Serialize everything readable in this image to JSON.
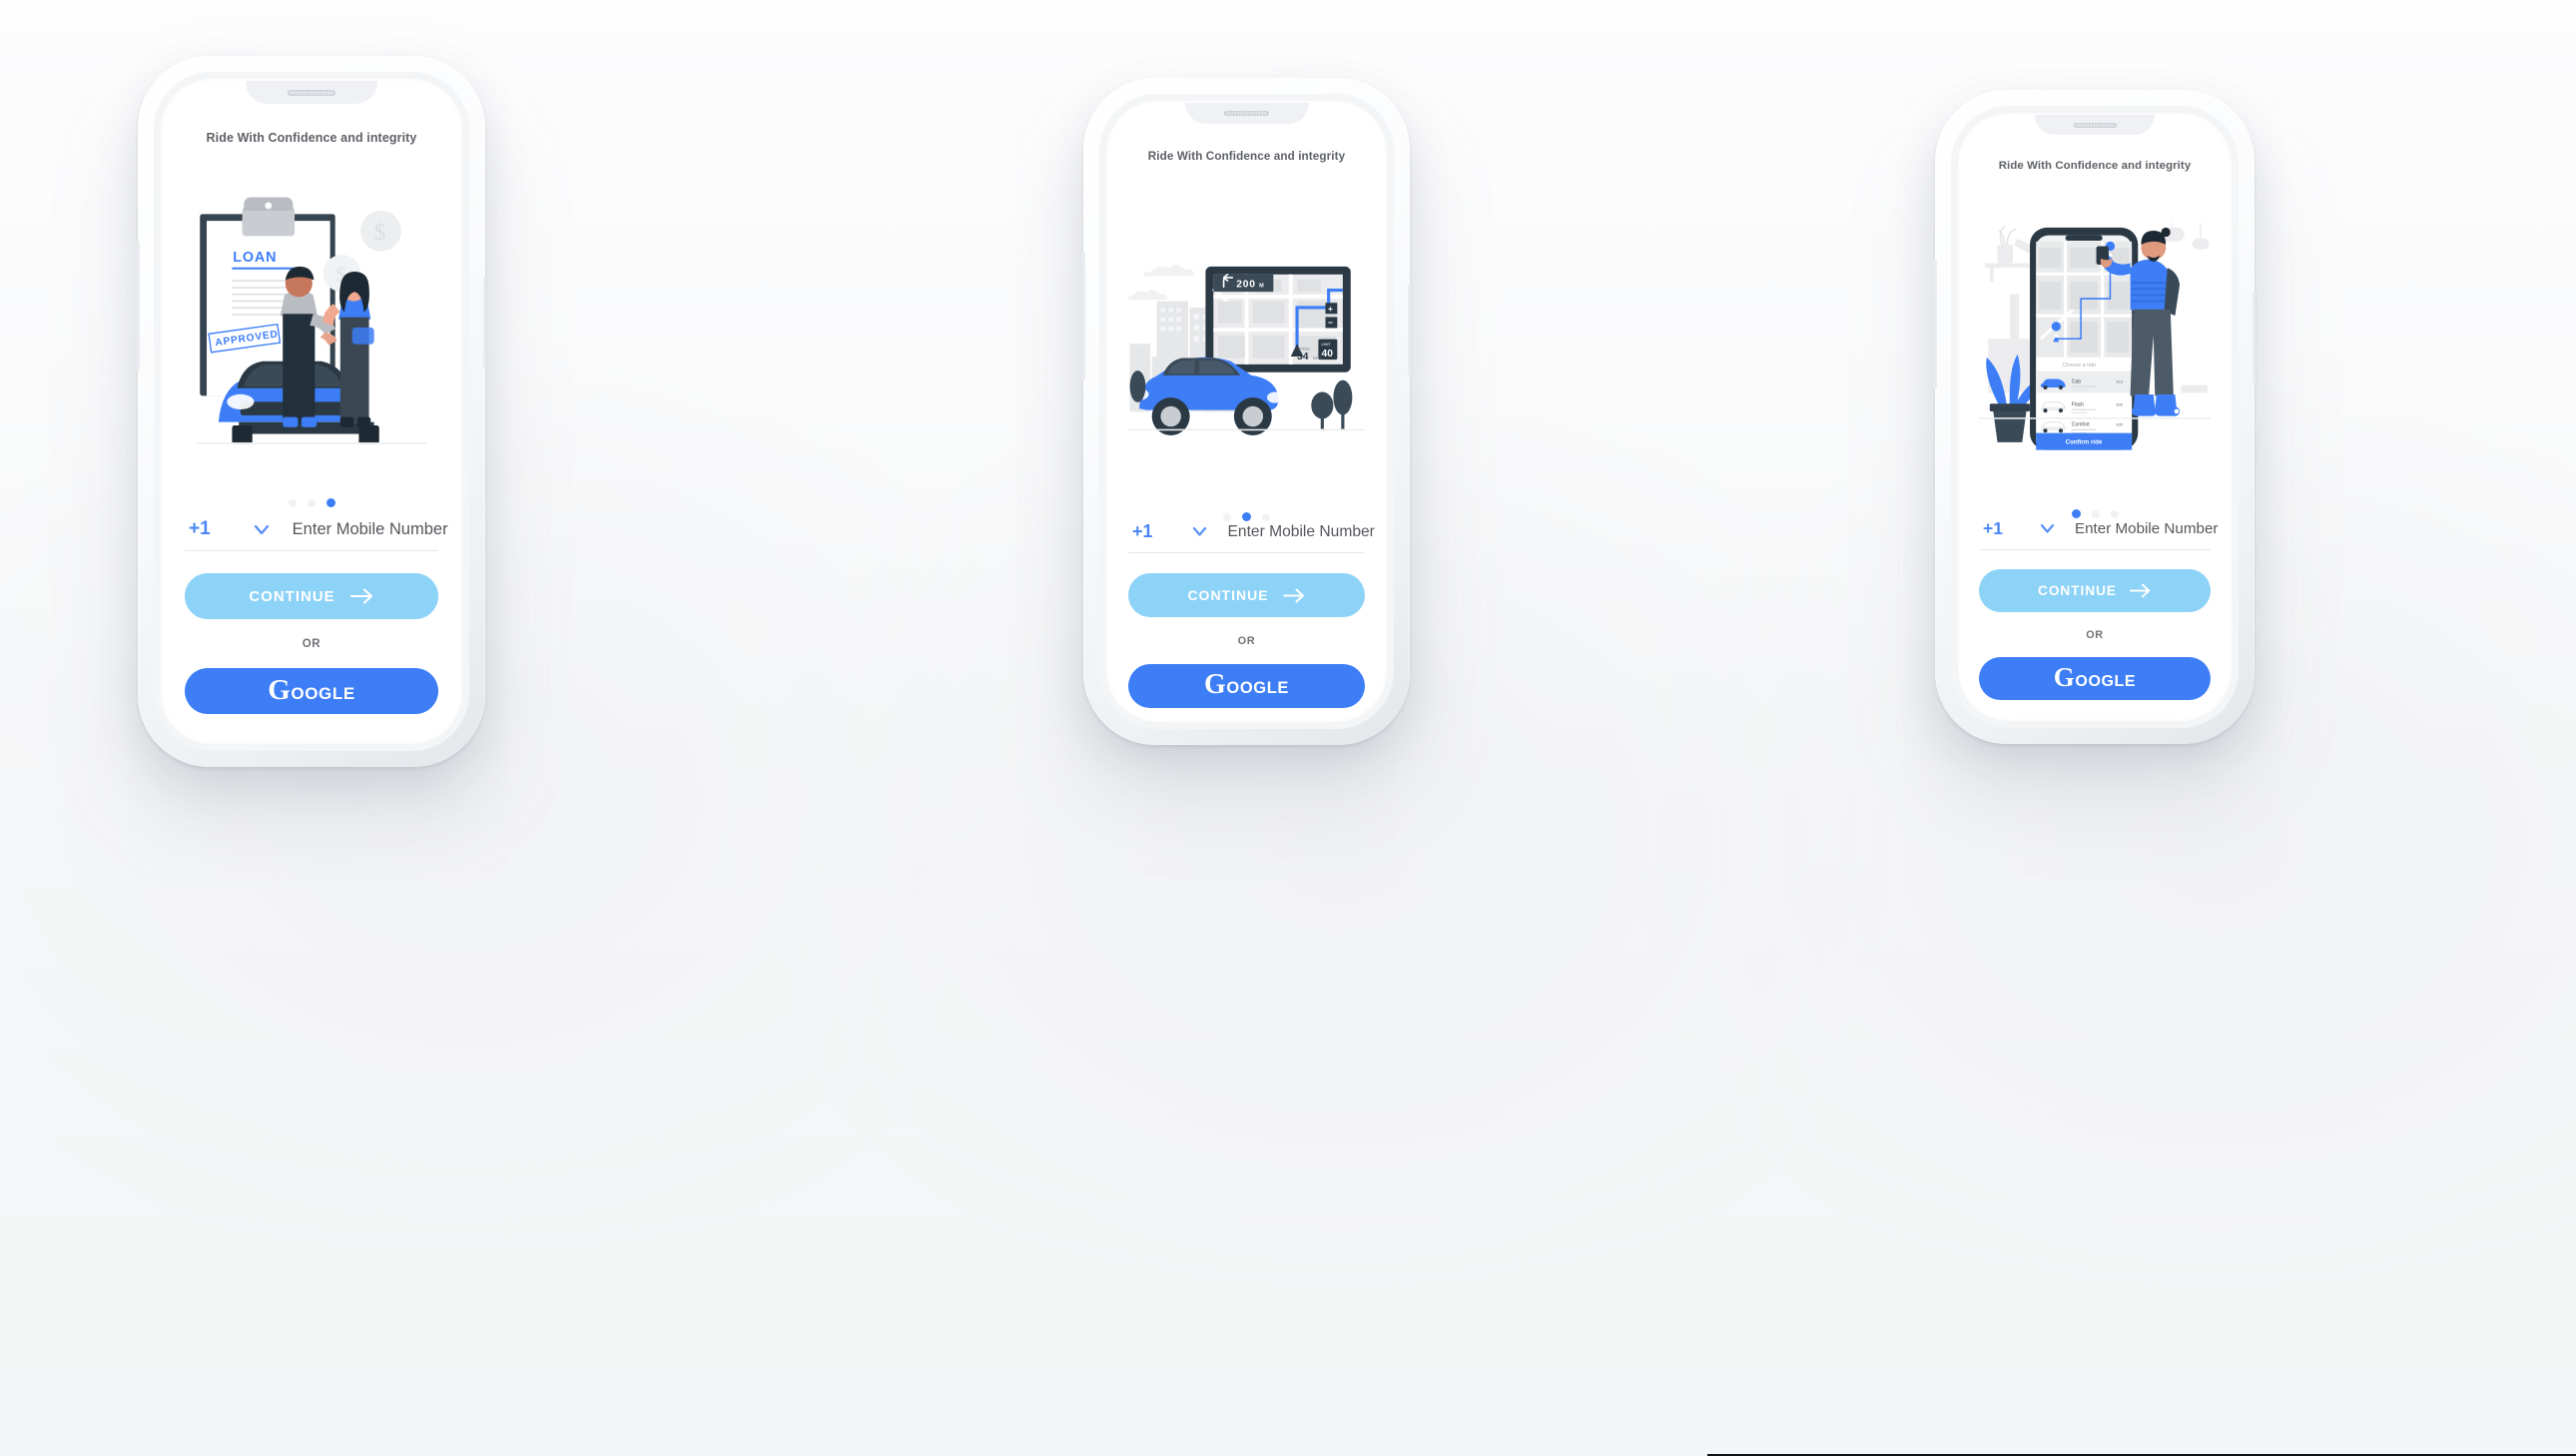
{
  "page": {
    "background_color": "#f5f6f7",
    "accent_blue": "#3d7ef7",
    "light_blue": "#8dd2f7",
    "text_gray": "#5e6166"
  },
  "phones": [
    {
      "id": "phone-1",
      "title": "Ride With Confidence and integrity",
      "illustration": {
        "name": "loan-approved-car-illustration",
        "labels": {
          "document_heading": "LOAN",
          "stamp": "APPROVED",
          "coin_symbol": "$"
        }
      },
      "pagination": {
        "count": 3,
        "active_index": 2
      },
      "form": {
        "country_code": "+1",
        "dropdown_icon": "chevron-down-icon",
        "mobile_placeholder": "Enter Mobile Number",
        "continue_label": "CONTINUE",
        "continue_icon": "arrow-right-icon",
        "divider_label": "OR",
        "google_logo_letter": "G",
        "google_label": "OOGLE"
      }
    },
    {
      "id": "phone-2",
      "title": "Ride With Confidence and integrity",
      "illustration": {
        "name": "car-gps-navigation-illustration",
        "labels": {
          "direction_distance": "200",
          "direction_unit": "M",
          "direction_icon": "turn-left-arrow-icon",
          "zoom_in": "+",
          "zoom_out": "−",
          "speed_limit_caption": "LIMIT",
          "speed_limit_value": "40",
          "speed_caption": "SPEED",
          "speed_value": "34",
          "speed_unit": "MPH"
        }
      },
      "pagination": {
        "count": 3,
        "active_index": 1
      },
      "form": {
        "country_code": "+1",
        "dropdown_icon": "chevron-down-icon",
        "mobile_placeholder": "Enter Mobile Number",
        "continue_label": "CONTINUE",
        "continue_icon": "arrow-right-icon",
        "divider_label": "OR",
        "google_logo_letter": "G",
        "google_label": "OOGLE"
      }
    },
    {
      "id": "phone-3",
      "title": "Ride With Confidence and integrity",
      "illustration": {
        "name": "ride-hailing-app-mockup-illustration",
        "labels": {
          "choose_a_ride": "Choose a ride",
          "confirm_button": "Confirm ride",
          "ride_options": [
            {
              "name": "Cab",
              "price": "$15"
            },
            {
              "name": "Flash",
              "price": "$35"
            },
            {
              "name": "Comfort",
              "price": "$35"
            }
          ]
        }
      },
      "pagination": {
        "count": 3,
        "active_index": 0
      },
      "form": {
        "country_code": "+1",
        "dropdown_icon": "chevron-down-icon",
        "mobile_placeholder": "Enter Mobile Number",
        "continue_label": "CONTINUE",
        "continue_icon": "arrow-right-icon",
        "divider_label": "OR",
        "google_logo_letter": "G",
        "google_label": "OOGLE"
      }
    }
  ]
}
